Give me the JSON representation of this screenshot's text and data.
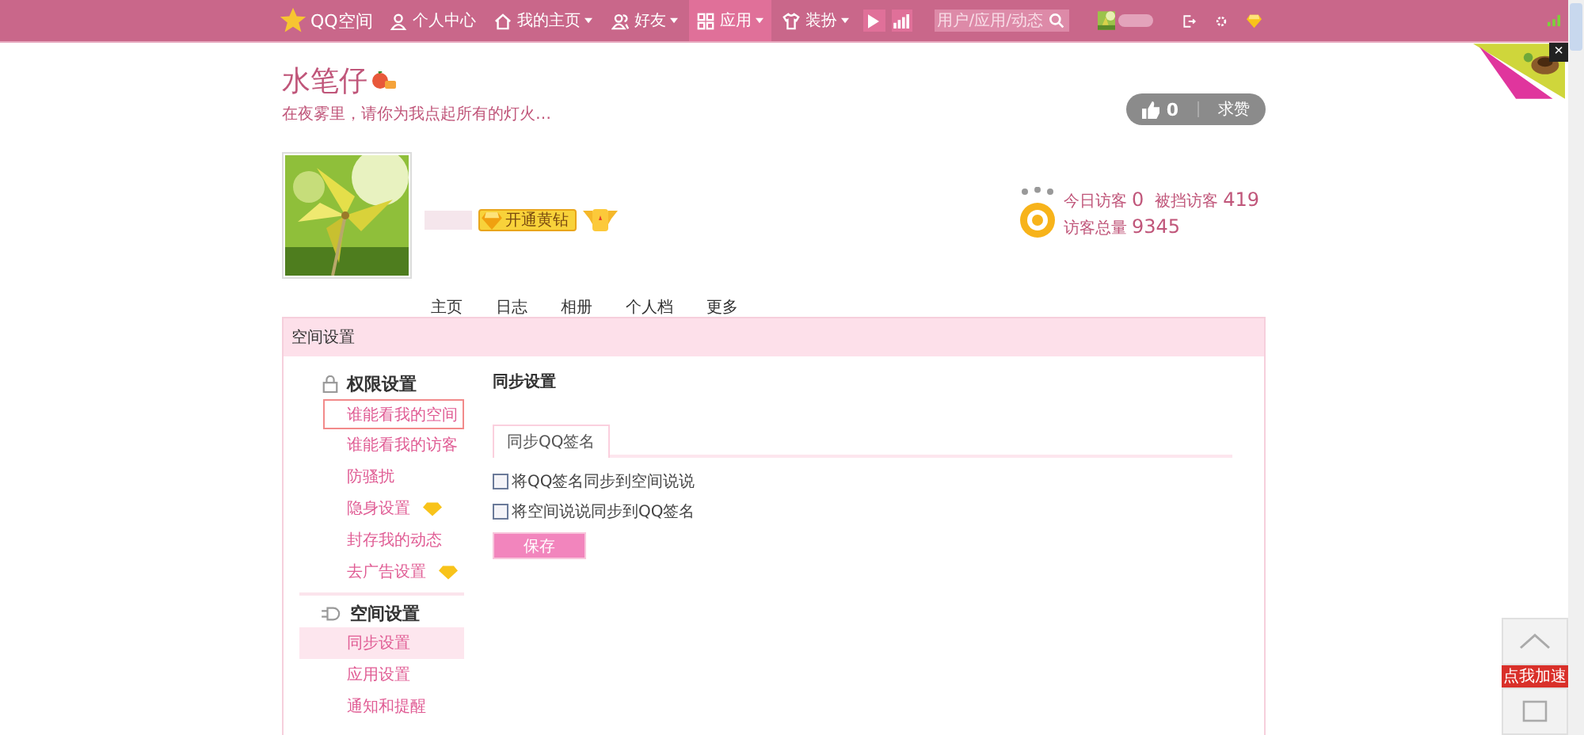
{
  "topbar": {
    "logo": "QQ空间",
    "nav": [
      {
        "label": "个人中心",
        "caret": false,
        "selected": false
      },
      {
        "label": "我的主页",
        "caret": true,
        "selected": false
      },
      {
        "label": "好友",
        "caret": true,
        "selected": false
      },
      {
        "label": "应用",
        "caret": true,
        "selected": true
      },
      {
        "label": "装扮",
        "caret": true,
        "selected": false
      }
    ],
    "search": {
      "placeholder": "用户/应用/动态"
    }
  },
  "profile": {
    "name": "水笔仔",
    "motto": "在夜雾里，请你为我点起所有的灯火…",
    "vip_button": "开通黄钻",
    "like": {
      "count": "0",
      "label": "求赞"
    },
    "visitors": [
      {
        "label": "今日访客",
        "value": "0"
      },
      {
        "label": "被挡访客",
        "value": "419"
      },
      {
        "label": "访客总量",
        "value": "9345"
      }
    ]
  },
  "tabs": [
    "主页",
    "日志",
    "相册",
    "个人档",
    "更多"
  ],
  "panel": {
    "title": "空间设置",
    "menu": [
      {
        "title": "权限设置",
        "items": [
          {
            "label": "谁能看我的空间",
            "selected": false,
            "focused": true,
            "vip": false
          },
          {
            "label": "谁能看我的访客",
            "selected": false,
            "focused": false,
            "vip": false
          },
          {
            "label": "防骚扰",
            "selected": false,
            "focused": false,
            "vip": false
          },
          {
            "label": "隐身设置",
            "selected": false,
            "focused": false,
            "vip": true
          },
          {
            "label": "封存我的动态",
            "selected": false,
            "focused": false,
            "vip": false
          },
          {
            "label": "去广告设置",
            "selected": false,
            "focused": false,
            "vip": true
          }
        ]
      },
      {
        "title": "空间设置",
        "items": [
          {
            "label": "同步设置",
            "selected": true,
            "focused": false,
            "vip": false
          },
          {
            "label": "应用设置",
            "selected": false,
            "focused": false,
            "vip": false
          },
          {
            "label": "通知和提醒",
            "selected": false,
            "focused": false,
            "vip": false
          }
        ]
      }
    ],
    "content": {
      "title": "同步设置",
      "tabs": [
        {
          "label": "同步QQ签名",
          "selected": true
        }
      ],
      "options": [
        {
          "label": "将QQ签名同步到空间说说",
          "checked": false
        },
        {
          "label": "将空间说说同步到QQ签名",
          "checked": false
        }
      ],
      "save": "保存"
    }
  },
  "corner": {
    "close": "×"
  },
  "float": {
    "badge": "点我加速"
  }
}
